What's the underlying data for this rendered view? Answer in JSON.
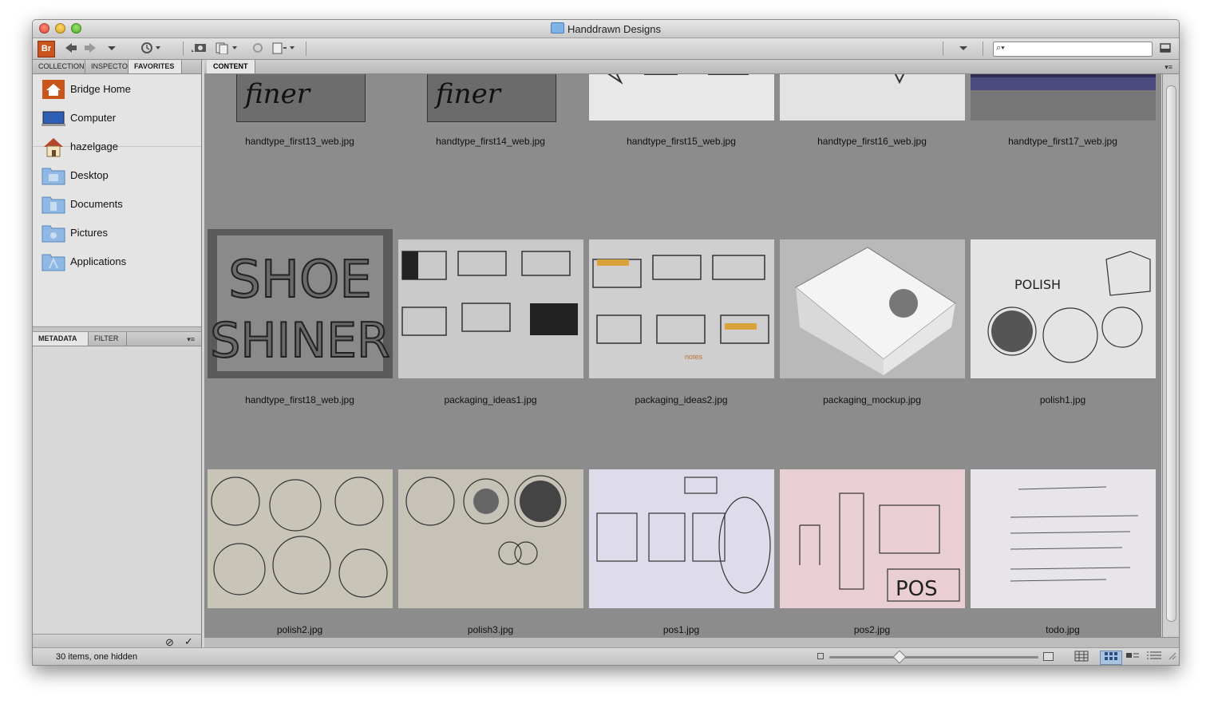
{
  "window": {
    "title": "Handdrawn Designs"
  },
  "toolbar": {
    "app_logo": "Br",
    "search_placeholder": ""
  },
  "left_panel": {
    "tabs": [
      "COLLECTION",
      "INSPECTO",
      "FAVORITES"
    ],
    "favorites": [
      {
        "label": "Bridge Home",
        "icon": "bridge-home-icon"
      },
      {
        "label": "Computer",
        "icon": "computer-icon"
      },
      {
        "label": "hazelgage",
        "icon": "home-icon"
      },
      {
        "label": "Desktop",
        "icon": "folder-icon"
      },
      {
        "label": "Documents",
        "icon": "folder-icon"
      },
      {
        "label": "Pictures",
        "icon": "folder-icon"
      },
      {
        "label": "Applications",
        "icon": "folder-icon"
      }
    ],
    "bottom_tabs": [
      "METADATA",
      "FILTER"
    ]
  },
  "content": {
    "tab": "CONTENT",
    "items": [
      {
        "name": "handtype_first13_web.jpg",
        "label": "finer",
        "color": "#6d6d6d"
      },
      {
        "name": "handtype_first14_web.jpg",
        "label": "finer",
        "color": "#6b6b6b"
      },
      {
        "name": "handtype_first15_web.jpg",
        "label": "",
        "color": "#e8e8e8"
      },
      {
        "name": "handtype_first16_web.jpg",
        "label": "",
        "color": "#e3e3e3"
      },
      {
        "name": "handtype_first17_web.jpg",
        "label": "",
        "color": "#4c4a7e"
      },
      {
        "name": "handtype_first18_web.jpg",
        "label": "SHOE SHINER",
        "color": "#5a5a5a"
      },
      {
        "name": "packaging_ideas1.jpg",
        "label": "",
        "color": "#c9c9c9"
      },
      {
        "name": "packaging_ideas2.jpg",
        "label": "",
        "color": "#cfcfcf"
      },
      {
        "name": "packaging_mockup.jpg",
        "label": "",
        "color": "#b9b9b9"
      },
      {
        "name": "polish1.jpg",
        "label": "POLISH",
        "color": "#e4e4e4"
      },
      {
        "name": "polish2.jpg",
        "label": "",
        "color": "#c9c4b8"
      },
      {
        "name": "polish3.jpg",
        "label": "",
        "color": "#c7c2b7"
      },
      {
        "name": "pos1.jpg",
        "label": "",
        "color": "#dedcea"
      },
      {
        "name": "pos2.jpg",
        "label": "POS",
        "color": "#e9cfd3"
      },
      {
        "name": "todo.jpg",
        "label": "",
        "color": "#e7e4ea"
      }
    ]
  },
  "status": {
    "text": "30 items, one hidden"
  }
}
